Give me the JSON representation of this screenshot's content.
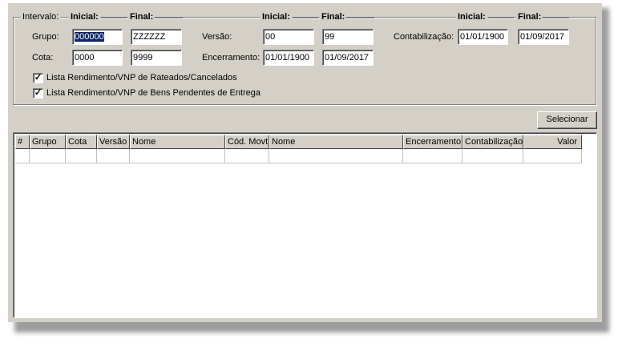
{
  "interval": {
    "legend": "Intervalo:",
    "col_initial": "Inicial:",
    "col_final": "Final:"
  },
  "fields": {
    "grupo": {
      "label": "Grupo:",
      "initial": "000000",
      "final": "ZZZZZZ"
    },
    "cota": {
      "label": "Cota:",
      "initial": "0000",
      "final": "9999"
    },
    "versao": {
      "label": "Versão:",
      "initial": "00",
      "final": "99"
    },
    "encerramento": {
      "label": "Encerramento:",
      "initial": "01/01/1900",
      "final": "01/09/2017"
    },
    "contabilizacao": {
      "label": "Contabilização:",
      "initial": "01/01/1900",
      "final": "01/09/2017"
    }
  },
  "options": [
    {
      "label": "Lista Rendimento/VNP de Rateados/Cancelados",
      "checked": true
    },
    {
      "label": "Lista Rendimento/VNP de Bens Pendentes de Entrega",
      "checked": true
    }
  ],
  "select_button": "Selecionar",
  "grid": {
    "columns": [
      "#",
      "Grupo",
      "Cota",
      "Versão",
      "Nome",
      "Cód. Movt.",
      "Nome",
      "Encerramento",
      "Contabilização",
      "Valor"
    ]
  }
}
